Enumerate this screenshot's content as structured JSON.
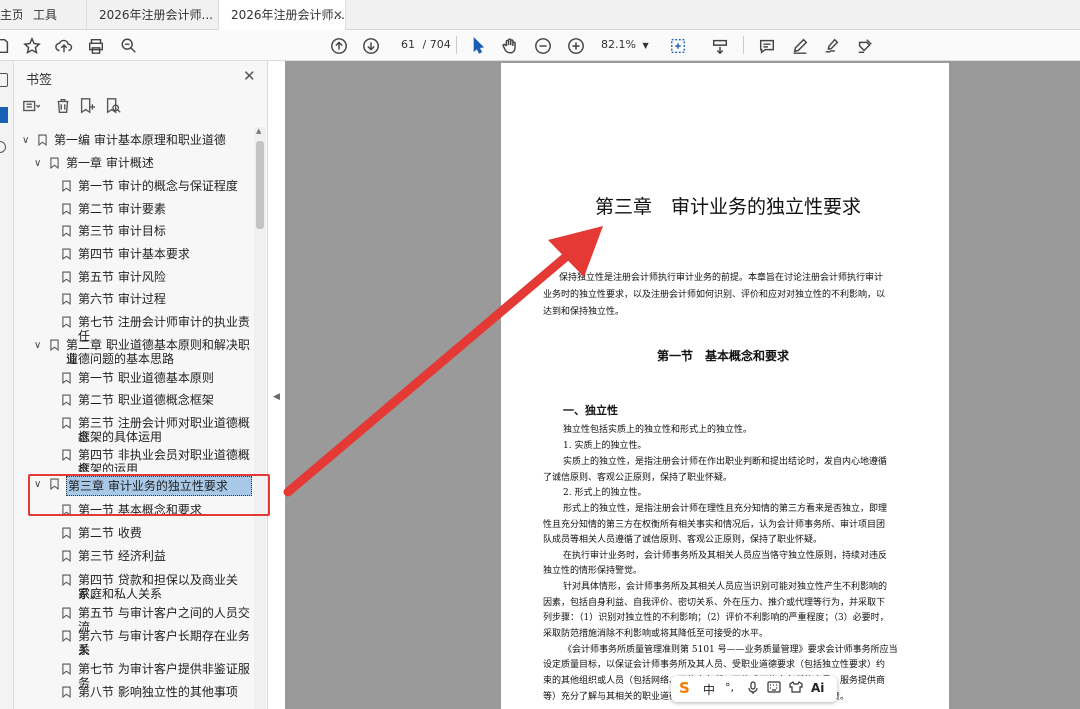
{
  "tabs": {
    "home": "主页",
    "tools": "工具",
    "doc1": "2026年注册会计师...",
    "doc2": "2026年注册会计师..."
  },
  "toolbar": {
    "page_current": "61",
    "page_total": "/ 704",
    "zoom": "82.1%"
  },
  "sidebar": {
    "title": "书签",
    "items": [
      {
        "label": "第一编 审计基本原理和职业道德"
      },
      {
        "label": "第一章 审计概述"
      },
      {
        "label": "第一节 审计的概念与保证程度"
      },
      {
        "label": "第二节 审计要素"
      },
      {
        "label": "第三节 审计目标"
      },
      {
        "label": "第四节 审计基本要求"
      },
      {
        "label": "第五节 审计风险"
      },
      {
        "label": "第六节 审计过程"
      },
      {
        "label": "第七节 注册会计师审计的执业责任"
      },
      {
        "label": "第二章 职业道德基本原则和解决职业",
        "label2": "道德问题的基本思路"
      },
      {
        "label": "第一节 职业道德基本原则"
      },
      {
        "label": "第二节 职业道德概念框架"
      },
      {
        "label": "第三节 注册会计师对职业道德概念",
        "label2": "框架的具体运用"
      },
      {
        "label": "第四节 非执业会员对职业道德概念",
        "label2": "框架的运用"
      },
      {
        "label": "第三章 审计业务的独立性要求"
      },
      {
        "label": "第一节 基本概念和要求"
      },
      {
        "label": "第二节 收费"
      },
      {
        "label": "第三节 经济利益"
      },
      {
        "label": "第四节 贷款和担保以及商业关系、",
        "label2": "家庭和私人关系"
      },
      {
        "label": "第五节 与审计客户之间的人员交流"
      },
      {
        "label": "第六节 与审计客户长期存在业务关",
        "label2": "系"
      },
      {
        "label": "第七节 为审计客户提供非鉴证服务"
      },
      {
        "label": "第八节 影响独立性的其他事项"
      }
    ]
  },
  "document": {
    "chapter_title": "第三章　审计业务的独立性要求",
    "intro": [
      "保持独立性是注册会计师执行审计业务的前提。本章旨在讨论注册会计师执行审计",
      "业务时的独立性要求，以及注册会计师如何识别、评价和应对对独立性的不利影响，以",
      "达到和保持独立性。"
    ],
    "section_title": "第一节　基本概念和要求",
    "sub_heading": "一、独立性",
    "body": [
      "独立性包括实质上的独立性和形式上的独立性。",
      "1. 实质上的独立性。",
      "实质上的独立性，是指注册会计师在作出职业判断和提出结论时，发自内心地遵循",
      "了诚信原则、客观公正原则，保持了职业怀疑。",
      "2. 形式上的独立性。",
      "形式上的独立性，是指注册会计师在理性且充分知情的第三方看来是否独立，即理",
      "性且充分知情的第三方在权衡所有相关事实和情况后，认为会计师事务所、审计项目团",
      "队成员等相关人员遵循了诚信原则、客观公正原则，保持了职业怀疑。",
      "在执行审计业务时，会计师事务所及其相关人员应当恪守独立性原则，持续对违反",
      "独立性的情形保持警觉。",
      "针对具体情形，会计师事务所及其相关人员应当识别可能对独立性产生不利影响的",
      "因素，包括自身利益、自我评价、密切关系、外在压力、推介或代理等行为，并采取下",
      "列步骤：（1）识别对独立性的不利影响；（2）评价不利影响的严重程度；（3）必要时，",
      "采取防范措施消除不利影响或将其降低至可接受的水平。",
      "《会计师事务所质量管理准则第 5101 号——业务质量管理》要求会计师事务所应当",
      "设定质量目标，以保证会计师事务所及其人员、受职业道德要求（包括独立性要求）约",
      "束的其他组织或人员（包括网络、网络事务所、网络或网络事务所的人员、服务提供商",
      "等）充分了解与其相关的职业道德要求，并按照这些职业道德要求履行职责。"
    ]
  },
  "ime": {
    "logo": "S",
    "lang": "中",
    "punct": "°,",
    "ai": "Ai"
  },
  "colors": {
    "highlight": "#a8c8e8",
    "annotation": "#e53935"
  }
}
